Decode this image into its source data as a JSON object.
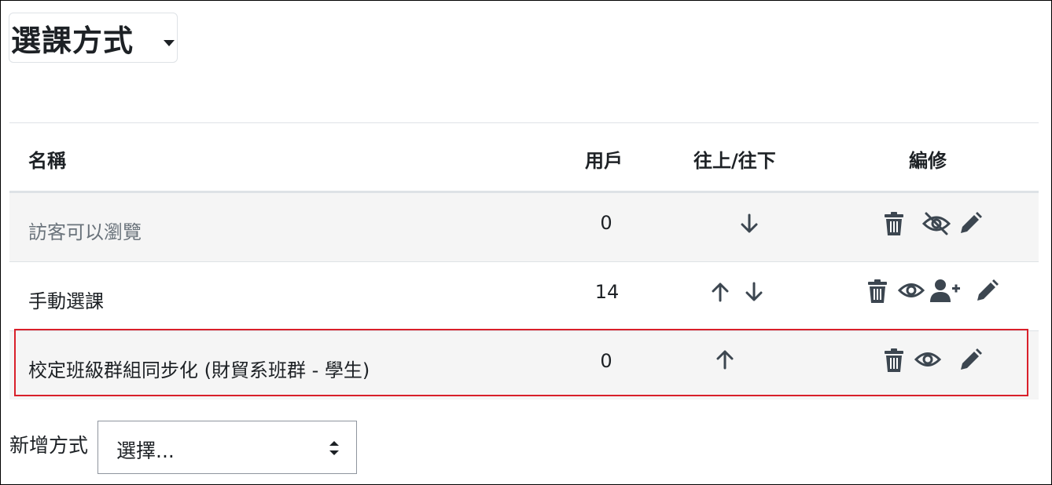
{
  "page_title": "選課方式",
  "table": {
    "headers": {
      "name": "名稱",
      "users": "用戶",
      "updown": "往上/往下",
      "edit": "編修"
    },
    "rows": [
      {
        "name": "訪客可以瀏覽",
        "users": "0",
        "status": "disabled"
      },
      {
        "name": "手動選課",
        "users": "14",
        "status": "enabled"
      },
      {
        "name": "校定班級群組同步化 (財貿系班群 - 學生)",
        "users": "0",
        "status": "enabled"
      }
    ]
  },
  "add_method": {
    "label": "新增方式",
    "selected": "選擇..."
  },
  "colors": {
    "text": "#1d2125",
    "dim_text": "#6a737b",
    "icon": "#3c4650",
    "highlight": "#d9202a",
    "row_shade": "#f5f5f5"
  }
}
